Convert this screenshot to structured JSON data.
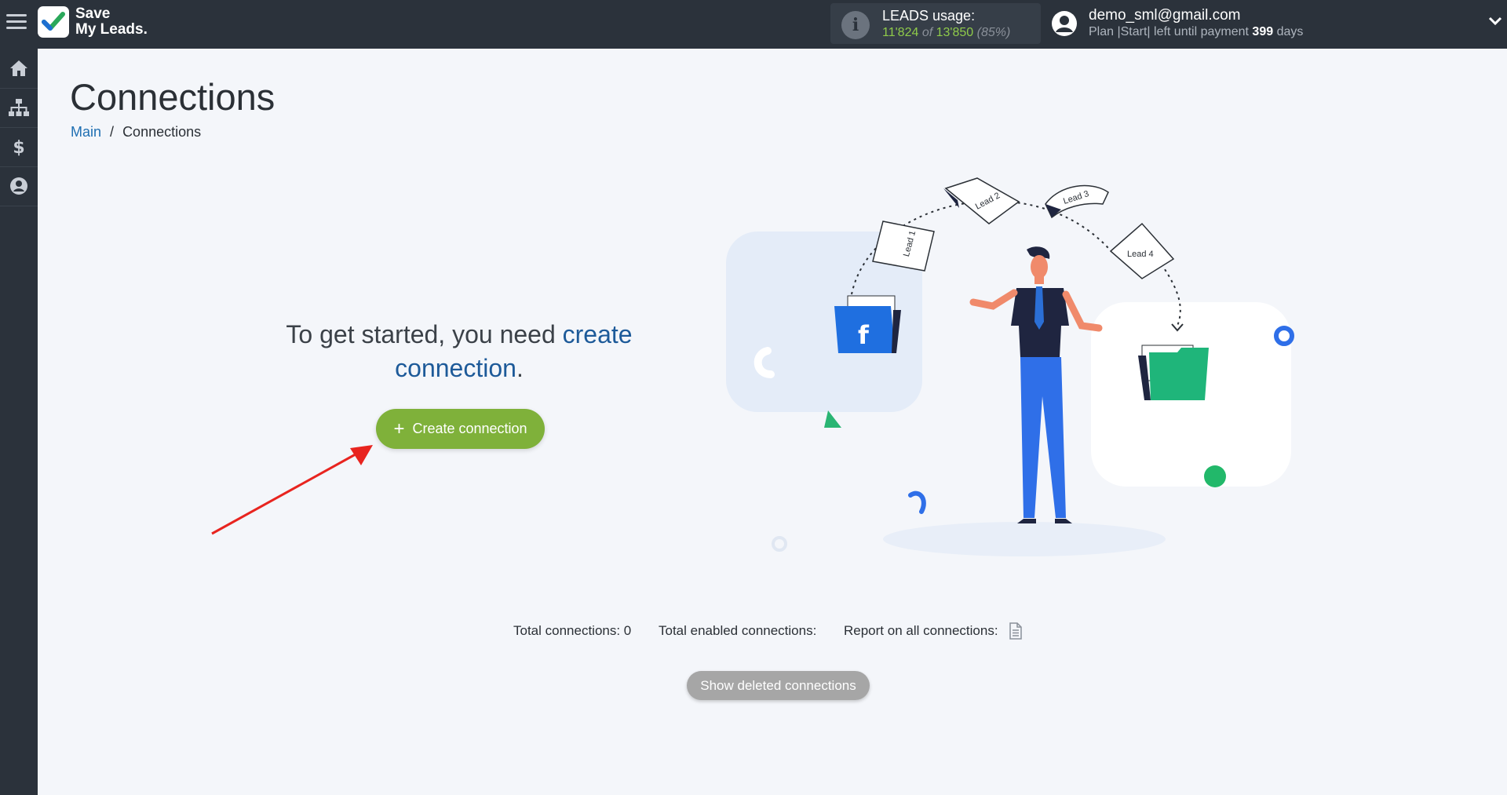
{
  "header": {
    "logo_line1": "Save",
    "logo_line2": "My Leads.",
    "usage_label": "LEADS usage:",
    "usage_used": "11'824",
    "usage_of": "of",
    "usage_total": "13'850",
    "usage_percent": "(85%)",
    "user_email": "demo_sml@gmail.com",
    "plan_text": "Plan |Start| left until payment",
    "days_value": "399",
    "days_label": "days"
  },
  "sidebar": {
    "items": [
      {
        "icon": "home-icon"
      },
      {
        "icon": "sitemap-icon"
      },
      {
        "icon": "dollar-icon"
      },
      {
        "icon": "user-circle-icon"
      }
    ]
  },
  "page": {
    "title": "Connections",
    "breadcrumb": [
      {
        "label": "Main"
      },
      {
        "label": "Connections"
      }
    ]
  },
  "empty_state": {
    "text_before": "To get started, you need",
    "link_text": "create connection",
    "text_after": ".",
    "button_label": "Create connection",
    "button_icon": "+"
  },
  "illustration": {
    "leads": [
      "Lead 1",
      "Lead 2",
      "Lead 3",
      "Lead 4"
    ]
  },
  "stats": {
    "total_label": "Total connections: 0",
    "enabled_label": "Total enabled connections:",
    "report_label": "Report on all connections:"
  },
  "show_deleted_label": "Show deleted connections",
  "colors": {
    "topbar": "#2b323b",
    "accent_green": "#7fb13a",
    "link_blue": "#1f6fb2",
    "usage_green": "#8fca4a"
  }
}
